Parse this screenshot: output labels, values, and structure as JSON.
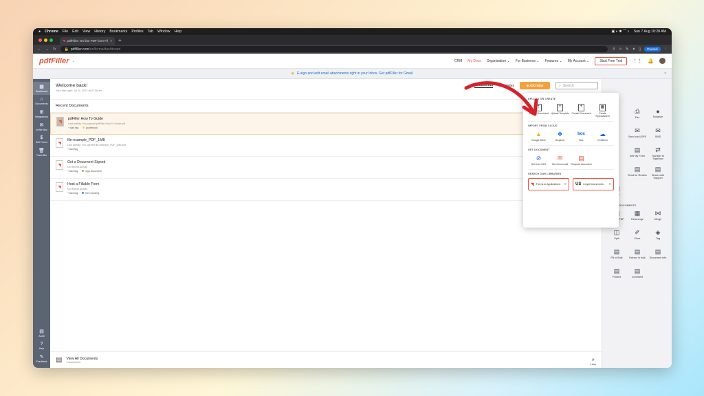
{
  "mac_menu": {
    "apple": "",
    "app": "Chrome",
    "items": [
      "File",
      "Edit",
      "View",
      "History",
      "Bookmarks",
      "Profiles",
      "Tab",
      "Window",
      "Help"
    ],
    "datetime": "Sun 7 Aug  10:28 AM"
  },
  "browser": {
    "tab_title": "pdfFiller: On-line PDF form Fil",
    "tab_close": "×",
    "new_tab": "+",
    "url_host": "pdffiller.com",
    "url_path": "/en/forms/dashboard",
    "profile": "Paused"
  },
  "header": {
    "logo": "pdfFiller",
    "nav": [
      "CRM",
      "My Docs",
      "Organisation",
      "For Business",
      "Features",
      "My Account"
    ],
    "active_nav": "My Docs",
    "trial_button": "Start Free Trial"
  },
  "banner": {
    "text": "E-sign and edit email attachments right in your Inbox. Get pdfFiller for Gmail.",
    "close": "×"
  },
  "sidebar": {
    "items": [
      {
        "label": "Dashboard",
        "icon": "dashboard-icon",
        "glyph": "▦"
      },
      {
        "label": "Documents",
        "icon": "home-icon",
        "glyph": "⌂"
      },
      {
        "label": "Integrations",
        "icon": "integrations-icon",
        "glyph": "⊞"
      },
      {
        "label": "InVite Box",
        "icon": "invite-icon",
        "glyph": "✉"
      },
      {
        "label": "Sell Forms",
        "icon": "sell-forms-icon",
        "glyph": "$"
      },
      {
        "label": "Trash Bin",
        "icon": "trash-icon",
        "glyph": "🗑"
      }
    ],
    "bottom": [
      {
        "label": "Audit",
        "glyph": "▤"
      },
      {
        "label": "Help",
        "glyph": "?"
      },
      {
        "label": "Feedback",
        "glyph": "✎"
      }
    ]
  },
  "welcome": {
    "title": "Welcome back!",
    "last_login": "Your last login: Jul 31, 2022 at 07:36 am"
  },
  "docs_header": {
    "tabs": [
      "Documents",
      "Templates"
    ],
    "add_new": "⊕  ADD NEW",
    "search_placeholder": "Search"
  },
  "recent": {
    "title": "Recent Documents",
    "open_button": "Ope",
    "items": [
      {
        "name": "pdFiller How To Guide",
        "activity": "Last activity: You opened pdfFiller How To Guide.pdf",
        "tag_label": "+ Add tag",
        "tag": "guidebook",
        "tag_color": "#f3d048"
      },
      {
        "name": "file-example_PDF_1MB",
        "activity": "Last activity: You opened file-example_PDF_1MB.pdf",
        "tag_label": "+ Add tag",
        "tag": "",
        "tag_color": ""
      },
      {
        "name": "Get a Document Signed",
        "activity": "No Recent Activity",
        "tag_label": "+ Add tag",
        "tag": "sign document",
        "tag_color": "#7dbb5a"
      },
      {
        "name": "Host a Fillable Form",
        "activity": "No Recent Activity",
        "tag_label": "+ Add tag",
        "tag": "form loading",
        "tag_color": "#3a8fd8"
      }
    ]
  },
  "footer": {
    "title": "View All Documents",
    "count": "4 documents",
    "less": "Less",
    "less_icon": "»"
  },
  "dropdown": {
    "upload_title": "UPLOAD OR CREATE",
    "upload": [
      {
        "label": "Upload Document",
        "glyph": "⇡"
      },
      {
        "label": "Upload Template",
        "glyph": "⇡"
      },
      {
        "label": "Create Document",
        "glyph": "+"
      },
      {
        "label": "Create Spreadsheet",
        "glyph": "▦"
      }
    ],
    "cloud_title": "IMPORT FROM CLOUD",
    "cloud": [
      {
        "label": "Google Drive",
        "glyph": "▲",
        "color": "#f4b400"
      },
      {
        "label": "Dropbox",
        "glyph": "❖",
        "color": "#0061fe"
      },
      {
        "label": "Box",
        "glyph": "box",
        "color": "#0061d5"
      },
      {
        "label": "OneDrive",
        "glyph": "☁",
        "color": "#0a6cd6"
      }
    ],
    "get_title": "GET DOCUMENT",
    "get": [
      {
        "label": "Get from URL",
        "glyph": "⊘",
        "color": "#2d6fb6"
      },
      {
        "label": "Get from email",
        "glyph": "✉",
        "color": "#e8533a"
      },
      {
        "label": "Request document",
        "glyph": "▤",
        "color": "#e8533a"
      }
    ],
    "libs_title": "SEARCH OUR LIBRARIES",
    "libs": [
      {
        "label": "Forms & Applications",
        "glyph": "◥"
      },
      {
        "label": "Legal Documents",
        "glyph": "US"
      }
    ]
  },
  "rpanel": {
    "top": [
      {
        "label": "",
        "glyph": ""
      },
      {
        "label": "Fax",
        "glyph": "⎙"
      },
      {
        "label": "Notarize",
        "glyph": "●"
      },
      {
        "label": "",
        "glyph": ""
      },
      {
        "label": "Send via USPS",
        "glyph": "✉"
      },
      {
        "label": "SMS",
        "glyph": "✉"
      },
      {
        "label": "",
        "glyph": ""
      },
      {
        "label": "Sell My Form",
        "glyph": "▤"
      },
      {
        "label": "Transfer to SignNow",
        "glyph": "⇄"
      },
      {
        "label": "",
        "glyph": ""
      },
      {
        "label": "Send for Review",
        "glyph": "▤"
      },
      {
        "label": "Share with Support",
        "glyph": "▤"
      },
      {
        "label": "Flow",
        "glyph": "▤"
      }
    ],
    "manage_title": "MANAGE DOCUMENTS",
    "manage": [
      {
        "label": "Rewrite PDF",
        "glyph": "▤"
      },
      {
        "label": "Rearrange",
        "glyph": "▦"
      },
      {
        "label": "Merge",
        "glyph": "⋈"
      },
      {
        "label": "Split",
        "glyph": "◫"
      },
      {
        "label": "Clear",
        "glyph": "✐"
      },
      {
        "label": "Tag",
        "glyph": "◈"
      },
      {
        "label": "Fill in Bulk",
        "glyph": "▤"
      },
      {
        "label": "Extract in bulk",
        "glyph": "▤"
      },
      {
        "label": "Document Info",
        "glyph": "▤"
      },
      {
        "label": "Protect",
        "glyph": "▤"
      },
      {
        "label": "Comment",
        "glyph": "▤"
      }
    ]
  },
  "colors": {
    "brand": "#e8533a",
    "add_new": "#f5a13d",
    "sidebar": "#5a6472",
    "arrow": "#d7212a"
  }
}
